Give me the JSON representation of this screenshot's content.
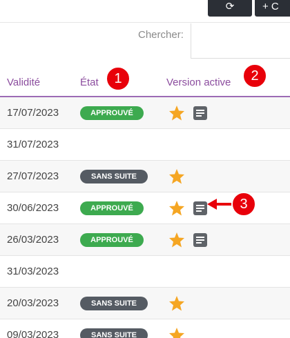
{
  "toolbar": {
    "refresh_glyph": "⟳",
    "add_label": "+ C"
  },
  "search": {
    "label": "Chercher:",
    "value": ""
  },
  "columns": {
    "validity": "Validité",
    "state": "État",
    "active_version": "Version active"
  },
  "callouts": [
    "1",
    "2",
    "3"
  ],
  "rows": [
    {
      "date": "17/07/2023",
      "status": "APPROUVÉ",
      "status_kind": "approved",
      "star": true,
      "doc": true
    },
    {
      "date": "31/07/2023",
      "status": "",
      "status_kind": "none",
      "star": false,
      "doc": false
    },
    {
      "date": "27/07/2023",
      "status": "SANS SUITE",
      "status_kind": "dismissed",
      "star": true,
      "doc": false
    },
    {
      "date": "30/06/2023",
      "status": "APPROUVÉ",
      "status_kind": "approved",
      "star": true,
      "doc": true
    },
    {
      "date": "26/03/2023",
      "status": "APPROUVÉ",
      "status_kind": "approved",
      "star": true,
      "doc": true
    },
    {
      "date": "31/03/2023",
      "status": "",
      "status_kind": "none",
      "star": false,
      "doc": false
    },
    {
      "date": "20/03/2023",
      "status": "SANS SUITE",
      "status_kind": "dismissed",
      "star": true,
      "doc": false
    },
    {
      "date": "09/03/2023",
      "status": "SANS SUITE",
      "status_kind": "dismissed",
      "star": true,
      "doc": false
    }
  ],
  "colors": {
    "accent": "#8b4c9e",
    "approved": "#3daa4f",
    "dismissed": "#555b63",
    "star": "#f5a623",
    "callout": "#e8000a"
  }
}
